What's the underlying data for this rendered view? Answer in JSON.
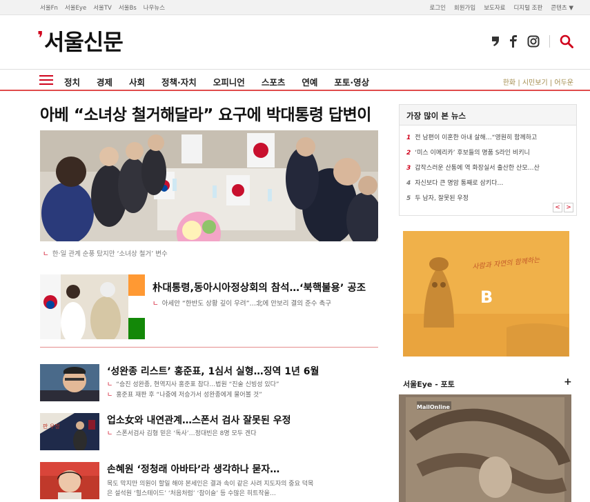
{
  "topbar": {
    "left": [
      "서울Fn",
      "서울Eye",
      "서울TV",
      "서울Bs",
      "나우뉴스"
    ],
    "right": [
      "로그인",
      "회원가입",
      "보도자료",
      "디지털 조판",
      "콘텐츠 ▼"
    ]
  },
  "logo": {
    "text": "서울신문"
  },
  "social": [
    "story-icon",
    "facebook-icon",
    "instagram-icon",
    "search-icon"
  ],
  "nav": {
    "items": [
      "정치",
      "경제",
      "사회",
      "정책·자치",
      "오피니언",
      "스포츠",
      "연예",
      "포토·영상"
    ],
    "extra": "한화 | 시민보기 | 어두운"
  },
  "main": {
    "headline": "아베 “소녀상 철거해달라” 요구에 박대통령 답변이",
    "caption": "한·일 관계 순풍 탔지만 ‘소녀상 철거’ 변수",
    "story2": {
      "title": "朴대통령,동아시아정상회의 참석…‘북핵불용’ 공조",
      "sub": "아세안 “한반도 상황 깊이 우려”…北에 안보리 결의 준수 촉구"
    },
    "stories": [
      {
        "title": "‘성완종 리스트’ 홍준표, 1심서 실형…징역 1년 6월",
        "subs": [
          "“승진 성완종, 현역지사 홍준표 참다…법원 “진술 신빙성 있다”",
          "홍준표 재판 후 “나중에 저승가서 성완종에게 물어볼 것”"
        ]
      },
      {
        "title": "업소女와 내연관계…스폰서 검사 잘못된 우정",
        "subs": [
          "스폰서검사 김형 믿은 ‘독사’…정대빈은 8명 모두 겐다"
        ]
      },
      {
        "title": "손혜원 ‘정청래 아바타’라 생각하나 묻자…",
        "subs": [
          "목도 막지만 의원이 할일 해야 본세인은 결과 속이 같은 사려 지도자의 중요 덕목",
          "은 설석원 ‘힐스테이드’ ‘처음처럼’ ‘참이슬’ 등 수많은 히트작을…"
        ]
      }
    ]
  },
  "popular": {
    "title": "가장 많이 본 뉴스",
    "items": [
      {
        "num": "1",
        "text": "전 남편이 이혼한 아내 살해…“영원히 함께하고"
      },
      {
        "num": "2",
        "text": "‘미스 이메리카’ 후보들의 명품 S라인 비키니"
      },
      {
        "num": "3",
        "text": "갑작스러운 산통에 역 화장실서 출산한 산모…산"
      },
      {
        "num": "4",
        "text": "자신보다 큰 명암 통째로 삼키다…"
      },
      {
        "num": "5",
        "text": "두 남자, 잘못된 우정"
      }
    ],
    "prev": "<",
    "next": ">"
  },
  "ad": {
    "letter": "B",
    "script": "사람과 자연의 함께하는"
  },
  "eye": {
    "title": "서울Eye - 포토",
    "plus": "+",
    "brand": "MailOnline"
  },
  "colors": {
    "accent": "#d0021b",
    "nav_border": "#e04a4a",
    "ad_bg": "#f0b14a"
  }
}
